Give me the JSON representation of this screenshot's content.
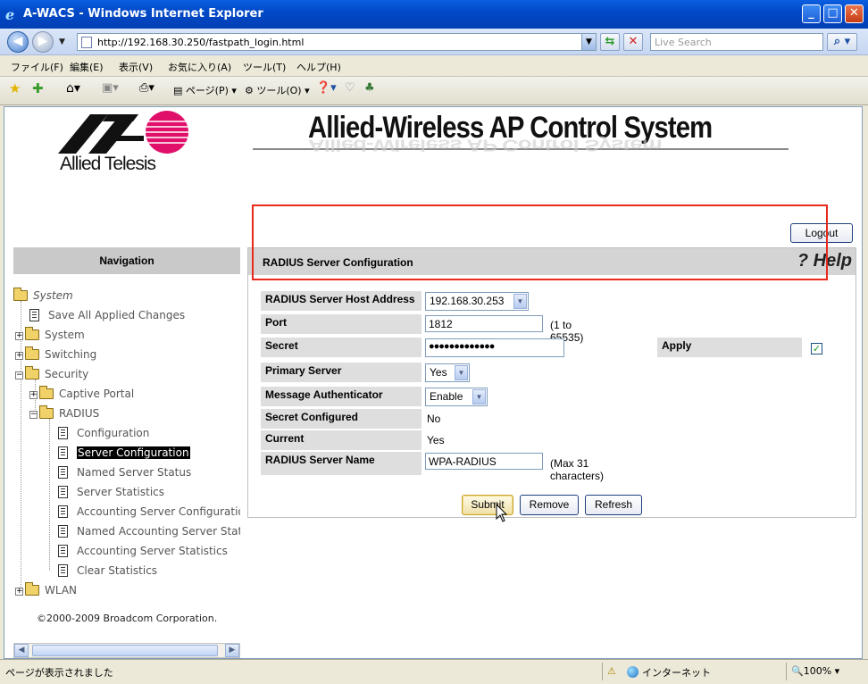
{
  "window": {
    "title": "A-WACS - Windows Internet Explorer",
    "min": "_",
    "max": "□",
    "close": "✕"
  },
  "address": {
    "url": "http://192.168.30.250/fastpath_login.html",
    "search_placeholder": "Live Search"
  },
  "menu": [
    "ファイル(F)",
    "編集(E)",
    "表示(V)",
    "お気に入り(A)",
    "ツール(T)",
    "ヘルプ(H)"
  ],
  "toolbar": {
    "page": "ページ(P)",
    "tools": "ツール(O)"
  },
  "header": {
    "brand": "Allied Telesis",
    "app_title": "Allied-Wireless AP Control System",
    "logout": "Logout"
  },
  "nav": {
    "heading": "Navigation",
    "root": "System",
    "save": "Save All Applied Changes",
    "system": "System",
    "switching": "Switching",
    "security": "Security",
    "captive": "Captive Portal",
    "radius": "RADIUS",
    "radius_items": [
      "Configuration",
      "Server Configuration",
      "Named Server Status",
      "Server Statistics",
      "Accounting Server Configuration",
      "Named Accounting Server Status",
      "Accounting Server Statistics",
      "Clear Statistics"
    ],
    "wlan": "WLAN",
    "copyright": "©2000-2009 Broadcom Corporation."
  },
  "panel": {
    "title": "RADIUS Server Configuration",
    "help": "? Help",
    "fields": {
      "host_label": "RADIUS Server Host Address",
      "host_value": "192.168.30.253",
      "port_label": "Port",
      "port_value": "1812",
      "port_hint": "(1 to 65535)",
      "secret_label": "Secret",
      "secret_value": "●●●●●●●●●●●●●",
      "apply_label": "Apply",
      "apply_checked": true,
      "primary_label": "Primary Server",
      "primary_value": "Yes",
      "msgauth_label": "Message Authenticator",
      "msgauth_value": "Enable",
      "secret_conf_label": "Secret Configured",
      "secret_conf_value": "No",
      "current_label": "Current",
      "current_value": "Yes",
      "name_label": "RADIUS Server Name",
      "name_value": "WPA-RADIUS",
      "name_hint": "(Max 31 characters)"
    },
    "buttons": {
      "submit": "Submit",
      "remove": "Remove",
      "refresh": "Refresh"
    }
  },
  "status": {
    "text": "ページが表示されました",
    "zone": "インターネット",
    "zoom": "100%"
  },
  "colors": {
    "highlight_box": "#e8291c",
    "titlebar": "#0249c8"
  }
}
